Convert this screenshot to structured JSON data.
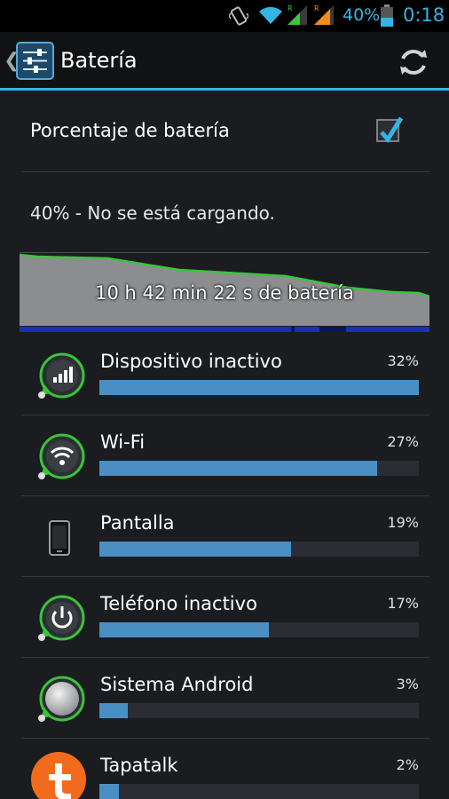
{
  "status_bar": {
    "battery_percent": "40%",
    "time": "0:18",
    "icons": [
      "vibrate-icon",
      "wifi-icon",
      "signal-icon-1",
      "signal-icon-2",
      "battery-icon"
    ]
  },
  "action_bar": {
    "title": "Batería",
    "icons": [
      "back-chevron-icon",
      "settings-app-icon",
      "refresh-icon"
    ]
  },
  "preference": {
    "label": "Porcentaje de batería",
    "checked": true
  },
  "battery_status": "40% - No se está cargando.",
  "graph": {
    "label": "10 h 42 min 22 s de batería",
    "level_fraction": 0.4
  },
  "usage": [
    {
      "name": "Dispositivo inactivo",
      "percent": "32%",
      "fill": 1.0,
      "icon": "signal-bars-icon"
    },
    {
      "name": "Wi-Fi",
      "percent": "27%",
      "fill": 0.87,
      "icon": "wifi-icon"
    },
    {
      "name": "Pantalla",
      "percent": "19%",
      "fill": 0.6,
      "icon": "phone-screen-icon"
    },
    {
      "name": "Teléfono inactivo",
      "percent": "17%",
      "fill": 0.53,
      "icon": "power-icon"
    },
    {
      "name": "Sistema Android",
      "percent": "3%",
      "fill": 0.09,
      "icon": "android-system-icon"
    },
    {
      "name": "Tapatalk",
      "percent": "2%",
      "fill": 0.06,
      "icon": "tapatalk-icon"
    }
  ],
  "colors": {
    "accent": "#33b5e5",
    "bar": "#4a8fc4",
    "graph_line": "#3cc43c",
    "icon_ring": "#39c43a",
    "tapatalk": "#f26b1d"
  }
}
